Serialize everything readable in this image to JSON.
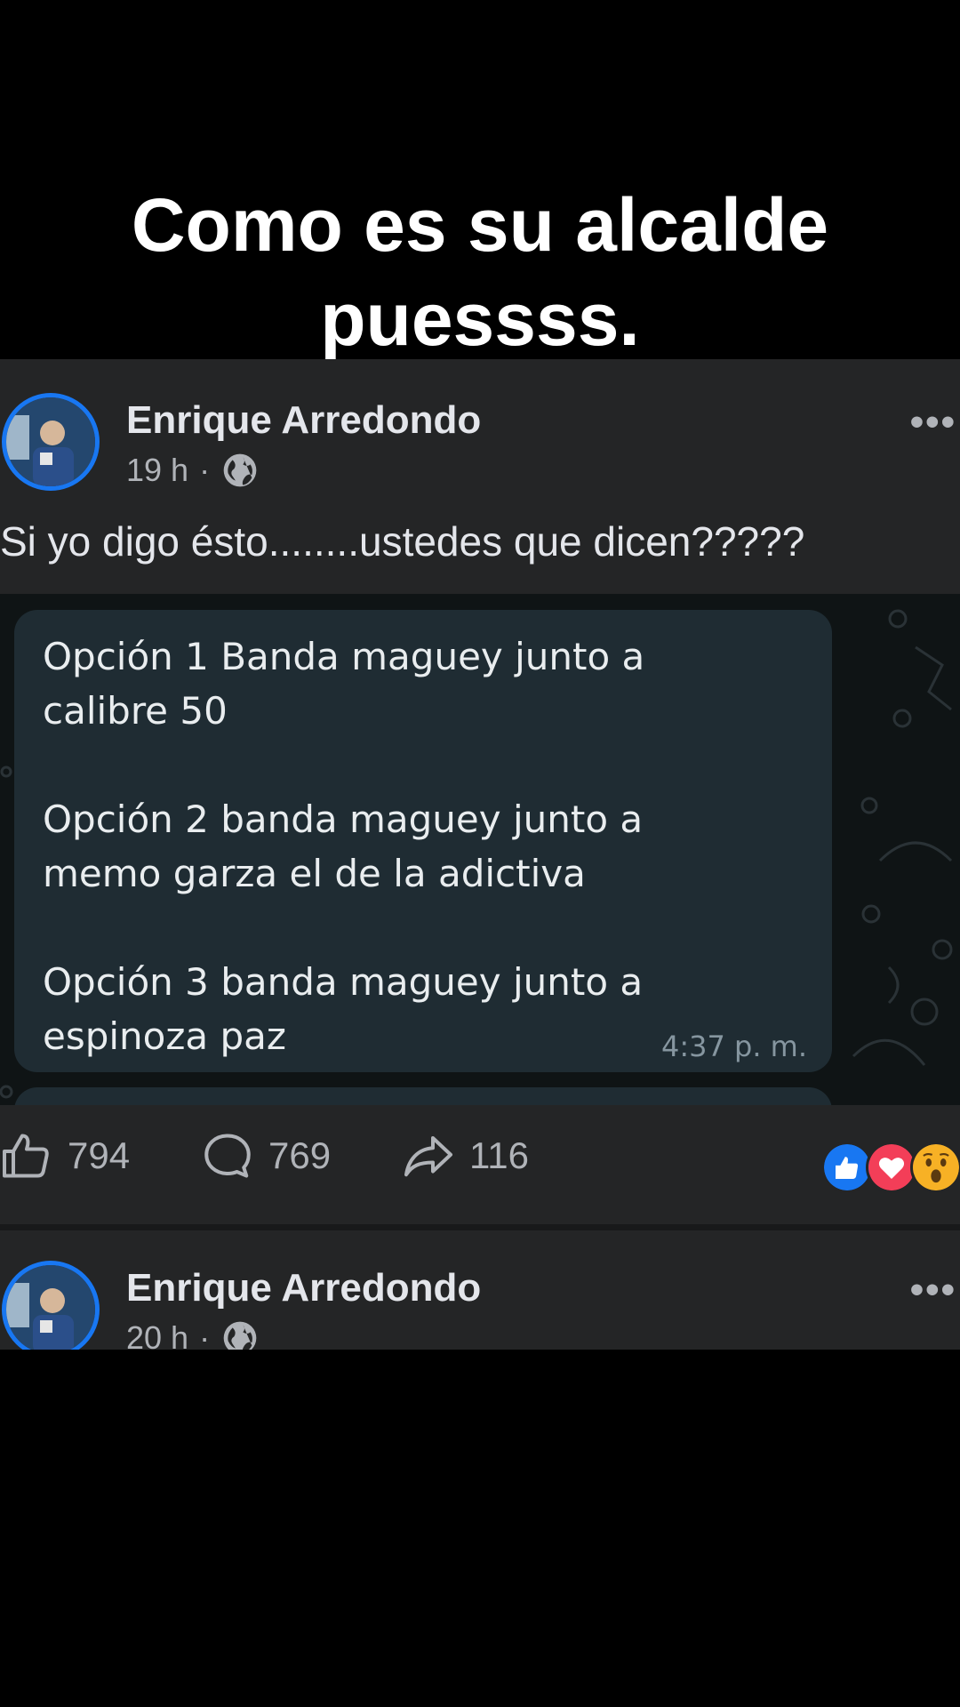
{
  "caption": {
    "line1": "Como es su alcalde",
    "line2": "puessss."
  },
  "post1": {
    "author": "Enrique Arredondo",
    "time": "19 h",
    "dot": "·",
    "privacy_icon": "globe-icon",
    "more_label": "•••",
    "text": "Si yo digo ésto........ustedes que dicen?????",
    "message": {
      "option1": [
        "Opción 1 Banda maguey junto a",
        "calibre 50"
      ],
      "option2": [
        "Opción  2 banda maguey  junto a",
        "memo garza el de la adictiva"
      ],
      "option3": [
        "Opción  3 banda maguey  junto a",
        "espinoza  paz"
      ],
      "time": "4:37 p. m."
    },
    "likes": "794",
    "comments": "769",
    "shares": "116",
    "reactions": [
      "like-icon",
      "love-icon",
      "wow-icon"
    ]
  },
  "post2": {
    "author": "Enrique Arredondo",
    "time": "20 h",
    "dot": "·",
    "privacy_icon": "globe-icon",
    "more_label": "•••"
  },
  "colors": {
    "accent": "#1877f2",
    "card": "#242526",
    "chat_bubble": "#1f2c33",
    "love": "#f33e58",
    "wow": "#f7b125"
  }
}
